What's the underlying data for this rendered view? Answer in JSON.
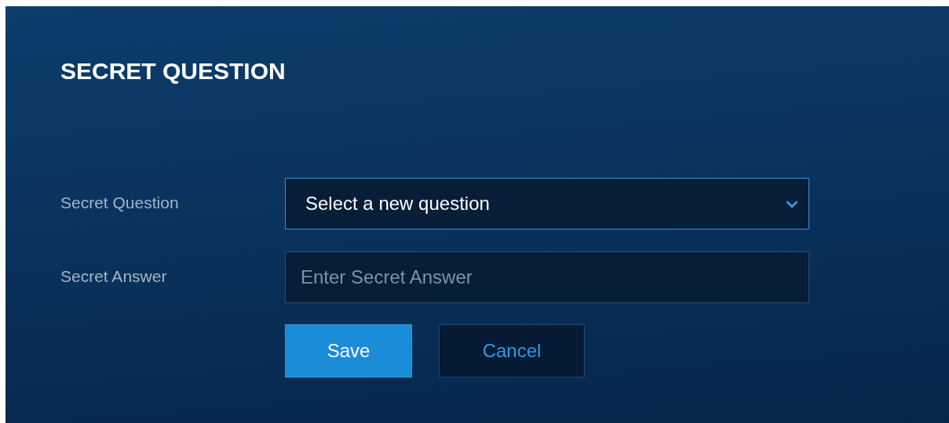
{
  "title": "SECRET QUESTION",
  "fields": [
    {
      "kind": "select",
      "label": "Secret Question",
      "value": "Select a new question",
      "focused": true
    },
    {
      "kind": "text",
      "label": "Secret Answer",
      "placeholder": "Enter Secret Answer",
      "focused": false
    }
  ],
  "buttons": [
    {
      "label": "Save",
      "kind": "primary"
    },
    {
      "label": "Cancel",
      "kind": "secondary"
    }
  ]
}
